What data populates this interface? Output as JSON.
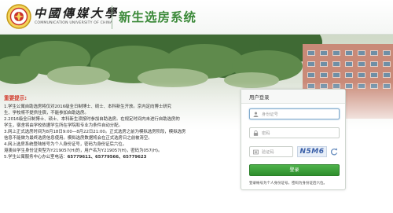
{
  "header": {
    "university_cn": "中國傳媒大學",
    "university_en": "COMMUNICATION UNIVERSITY OF CHINA",
    "system_title": "新生选房系统",
    "accent_color": "#3c8a3a"
  },
  "notice": {
    "title": "重要提示:",
    "title_color": "#d23b2c",
    "lines": [
      "1.学生公寓自助选房将仅对2016级全日制博士、硕士、本科新生开放。京内定向博士研究",
      "生、学校将不提供住宿，不能参加自助选房。",
      "2.2016级全日制博士、硕士、本科新生须按时参加自助选房。在规定时间内未进行自助选房的",
      "学生，宿舍将由学校依据学生所在学院和专业为条件自动分配。",
      "3.网上正式选房时间为8月18日9:00—8月22日21:00。正式选房之前为模拟选房阶段，模拟选房",
      "信息不能做为最终选房信息使用。模拟选房数据将会在正式选房日之前被清空。",
      "4.网上选房系统登陆帐号为个人身份证号，密码为身份证后六位。",
      "港澳台学生身份证类型为Y219057(H)的，用户名为Y219057(H)，密码为057(H)。"
    ],
    "phone_prefix": "5.学生公寓服务中心办公室电话：",
    "phones": "65779611、65779566、65779623"
  },
  "login": {
    "heading": "用户登录",
    "id_placeholder": "身份证号",
    "password_placeholder": "密码",
    "captcha_placeholder": "验证码",
    "captcha_text": "N5M6",
    "button_label": "登录",
    "button_color": "#3a9a37",
    "hint": "登录帐号为个人身份证号，密码为身份证后六位。"
  },
  "icons": [
    "university-seal-icon",
    "user-icon",
    "lock-icon",
    "captcha-icon",
    "refresh-icon"
  ]
}
